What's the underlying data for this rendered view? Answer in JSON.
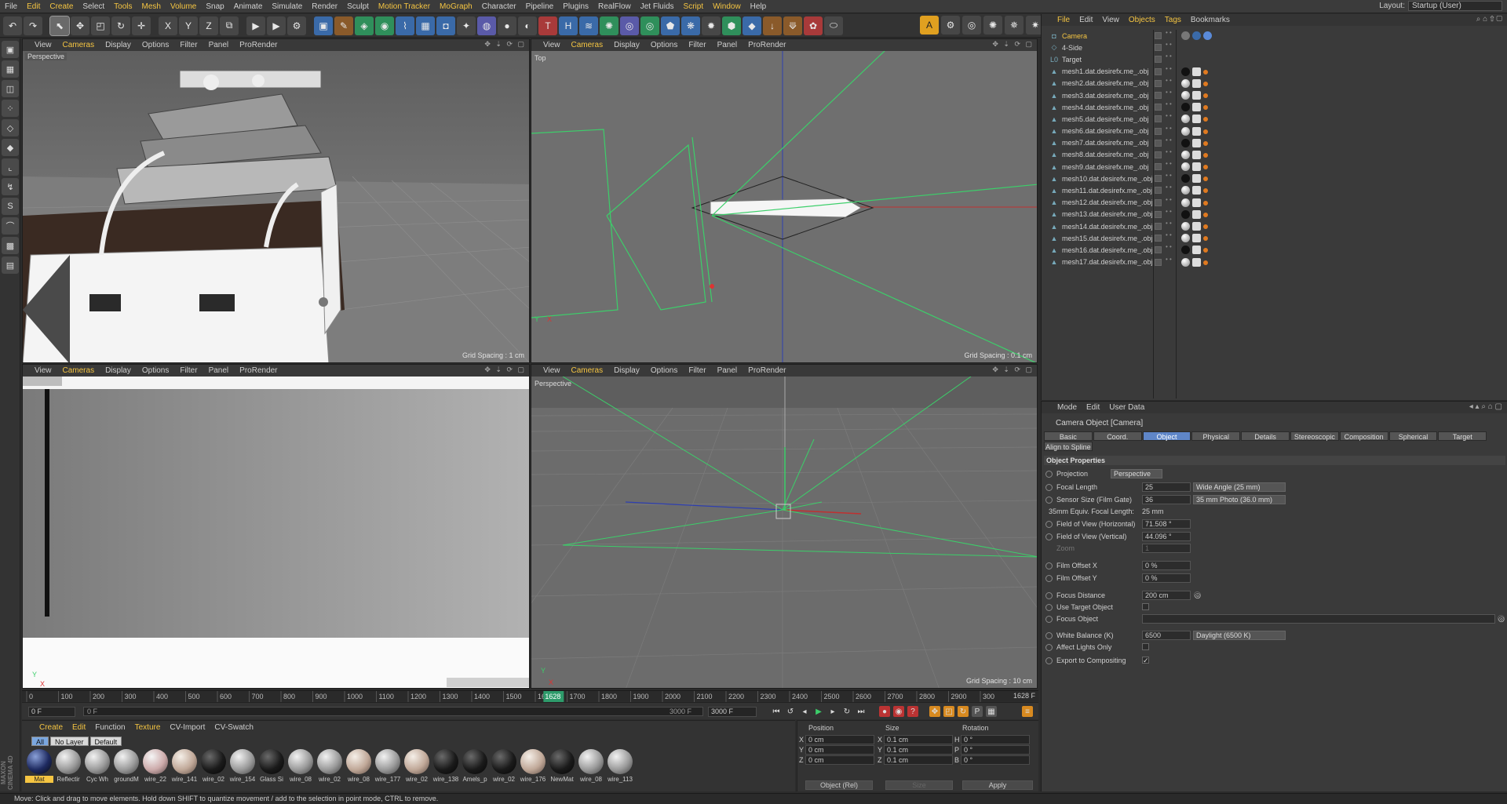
{
  "menubar": {
    "items": [
      "File",
      "Edit",
      "Create",
      "Select",
      "Tools",
      "Mesh",
      "Volume",
      "Snap",
      "Animate",
      "Simulate",
      "Render",
      "Sculpt",
      "Motion Tracker",
      "MoGraph",
      "Character",
      "Pipeline",
      "Plugins",
      "RealFlow",
      "Jet Fluids",
      "Script",
      "Window",
      "Help"
    ],
    "highlight": [
      "Edit",
      "Create",
      "Tools",
      "Mesh",
      "Volume",
      "Motion Tracker",
      "MoGraph",
      "Script",
      "Window"
    ],
    "layout_label": "Layout:",
    "layout_value": "Startup (User)"
  },
  "viewports": {
    "top_left": {
      "menu": [
        "View",
        "Cameras",
        "Display",
        "Options",
        "Filter",
        "Panel",
        "ProRender"
      ],
      "label": "Perspective",
      "grid": "Grid Spacing : 1 cm"
    },
    "top_right": {
      "menu": [
        "View",
        "Cameras",
        "Display",
        "Options",
        "Filter",
        "Panel",
        "ProRender"
      ],
      "label": "Top",
      "grid": "Grid Spacing : 0.1 cm"
    },
    "bottom_left": {
      "menu": [
        "View",
        "Cameras",
        "Display",
        "Options",
        "Filter",
        "Panel",
        "ProRender"
      ]
    },
    "bottom_right": {
      "menu": [
        "View",
        "Cameras",
        "Display",
        "Options",
        "Filter",
        "Panel",
        "ProRender"
      ],
      "label": "Perspective",
      "grid": "Grid Spacing : 10 cm"
    }
  },
  "timeline": {
    "ticks": [
      "0",
      "100",
      "200",
      "300",
      "400",
      "500",
      "600",
      "700",
      "800",
      "900",
      "1000",
      "1100",
      "1200",
      "1300",
      "1400",
      "1500",
      "1600",
      "1700",
      "1800",
      "1900",
      "2000",
      "2100",
      "2200",
      "2300",
      "2400",
      "2500",
      "2600",
      "2700",
      "2800",
      "2900",
      "300"
    ],
    "current_marker": "1628",
    "current_readout": "1628 F"
  },
  "transport": {
    "start": "0 F",
    "scrub_start": "0 F",
    "scrub_end": "3000 F",
    "end": "3000 F"
  },
  "material_manager": {
    "menu": [
      "Create",
      "Edit",
      "Function",
      "Texture",
      "CV-Import",
      "CV-Swatch"
    ],
    "menu_highlight": [
      "Create",
      "Edit",
      "Texture"
    ],
    "tabs": [
      "All",
      "No Layer",
      "Default"
    ],
    "materials": [
      {
        "name": "Mat",
        "style": "mat0"
      },
      {
        "name": "Reflectir",
        "style": ""
      },
      {
        "name": "Cyc Wh",
        "style": ""
      },
      {
        "name": "groundM",
        "style": ""
      },
      {
        "name": "wire_22",
        "style": "rd"
      },
      {
        "name": "wire_141",
        "style": "tex"
      },
      {
        "name": "wire_02",
        "style": "dk"
      },
      {
        "name": "wire_154",
        "style": ""
      },
      {
        "name": "Glass Si",
        "style": "dk"
      },
      {
        "name": "wire_08",
        "style": ""
      },
      {
        "name": "wire_02",
        "style": ""
      },
      {
        "name": "wire_08",
        "style": "tex"
      },
      {
        "name": "wire_177",
        "style": ""
      },
      {
        "name": "wire_02",
        "style": "tex"
      },
      {
        "name": "wire_138",
        "style": "dk"
      },
      {
        "name": "Amels_p",
        "style": "dk"
      },
      {
        "name": "wire_02",
        "style": "dk"
      },
      {
        "name": "wire_176",
        "style": "tex"
      },
      {
        "name": "NewMat",
        "style": "dk"
      },
      {
        "name": "wire_08",
        "style": ""
      },
      {
        "name": "wire_113",
        "style": ""
      }
    ]
  },
  "coord_manager": {
    "headers": [
      "Position",
      "Size",
      "Rotation"
    ],
    "rows": [
      {
        "a": "X",
        "pos": "0 cm",
        "b": "X",
        "size": "0.1 cm",
        "c": "H",
        "rot": "0 °"
      },
      {
        "a": "Y",
        "pos": "0 cm",
        "b": "Y",
        "size": "0.1 cm",
        "c": "P",
        "rot": "0 °"
      },
      {
        "a": "Z",
        "pos": "0 cm",
        "b": "Z",
        "size": "0.1 cm",
        "c": "B",
        "rot": "0 °"
      }
    ],
    "mode": "Object (Rel)",
    "size_mode": "Size",
    "apply": "Apply"
  },
  "status": "Move: Click and drag to move elements. Hold down SHIFT to quantize movement / add to the selection in point mode, CTRL to remove.",
  "object_manager": {
    "menu": [
      "File",
      "Edit",
      "View",
      "Objects",
      "Tags",
      "Bookmarks"
    ],
    "menu_highlight": [
      "File",
      "Objects",
      "Tags"
    ],
    "objects": [
      {
        "icon": "camera-icon",
        "glyph": "◘",
        "name": "Camera",
        "selected": true
      },
      {
        "icon": "tetrahedron-icon",
        "glyph": "◇",
        "name": "4-Side",
        "selected": false
      },
      {
        "icon": "null-target-icon",
        "glyph": "L0",
        "name": "Target",
        "selected": false
      },
      {
        "icon": "mesh-icon",
        "glyph": "▲",
        "name": "mesh1.dat.desirefx.me_.obj",
        "selected": false
      },
      {
        "icon": "mesh-icon",
        "glyph": "▲",
        "name": "mesh2.dat.desirefx.me_.obj",
        "selected": false
      },
      {
        "icon": "mesh-icon",
        "glyph": "▲",
        "name": "mesh3.dat.desirefx.me_.obj",
        "selected": false
      },
      {
        "icon": "mesh-icon",
        "glyph": "▲",
        "name": "mesh4.dat.desirefx.me_.obj",
        "selected": false
      },
      {
        "icon": "mesh-icon",
        "glyph": "▲",
        "name": "mesh5.dat.desirefx.me_.obj",
        "selected": false
      },
      {
        "icon": "mesh-icon",
        "glyph": "▲",
        "name": "mesh6.dat.desirefx.me_.obj",
        "selected": false
      },
      {
        "icon": "mesh-icon",
        "glyph": "▲",
        "name": "mesh7.dat.desirefx.me_.obj",
        "selected": false
      },
      {
        "icon": "mesh-icon",
        "glyph": "▲",
        "name": "mesh8.dat.desirefx.me_.obj",
        "selected": false
      },
      {
        "icon": "mesh-icon",
        "glyph": "▲",
        "name": "mesh9.dat.desirefx.me_.obj",
        "selected": false
      },
      {
        "icon": "mesh-icon",
        "glyph": "▲",
        "name": "mesh10.dat.desirefx.me_.obj",
        "selected": false
      },
      {
        "icon": "mesh-icon",
        "glyph": "▲",
        "name": "mesh11.dat.desirefx.me_.obj",
        "selected": false
      },
      {
        "icon": "mesh-icon",
        "glyph": "▲",
        "name": "mesh12.dat.desirefx.me_.obj",
        "selected": false
      },
      {
        "icon": "mesh-icon",
        "glyph": "▲",
        "name": "mesh13.dat.desirefx.me_.obj",
        "selected": false
      },
      {
        "icon": "mesh-icon",
        "glyph": "▲",
        "name": "mesh14.dat.desirefx.me_.obj",
        "selected": false
      },
      {
        "icon": "mesh-icon",
        "glyph": "▲",
        "name": "mesh15.dat.desirefx.me_.obj",
        "selected": false
      },
      {
        "icon": "mesh-icon",
        "glyph": "▲",
        "name": "mesh16.dat.desirefx.me_.obj",
        "selected": false
      },
      {
        "icon": "mesh-icon",
        "glyph": "▲",
        "name": "mesh17.dat.desirefx.me_.obj",
        "selected": false
      }
    ]
  },
  "attribute_manager": {
    "menu": [
      "Mode",
      "Edit",
      "User Data"
    ],
    "title": "Camera Object [Camera]",
    "tabs": [
      "Basic",
      "Coord.",
      "Object",
      "Physical",
      "Details",
      "Stereoscopic",
      "Composition",
      "Spherical",
      "Target",
      "Align to Spline"
    ],
    "active_tab": "Object",
    "section": "Object Properties",
    "projection_label": "Projection",
    "projection_value": "Perspective",
    "focal_length_label": "Focal Length",
    "focal_length_value": "25",
    "focal_length_preset": "Wide Angle (25 mm)",
    "sensor_label": "Sensor Size (Film Gate)",
    "sensor_value": "36",
    "sensor_preset": "35 mm Photo (36.0 mm)",
    "equiv_label": "35mm Equiv. Focal Length:",
    "equiv_value": "25 mm",
    "fovh_label": "Field of View (Horizontal)",
    "fovh_value": "71.508 °",
    "fovv_label": "Field of View (Vertical)",
    "fovv_value": "44.096 °",
    "zoom_label": "Zoom",
    "zoom_value": "1",
    "offx_label": "Film Offset X",
    "offx_value": "0 %",
    "offy_label": "Film Offset Y",
    "offy_value": "0 %",
    "focus_label": "Focus Distance",
    "focus_value": "200 cm",
    "use_target_label": "Use Target Object",
    "focus_obj_label": "Focus Object",
    "wb_label": "White Balance (K)",
    "wb_value": "6500",
    "wb_preset": "Daylight (6500 K)",
    "affect_label": "Affect Lights Only",
    "export_label": "Export to Compositing",
    "export_check": "✓"
  }
}
